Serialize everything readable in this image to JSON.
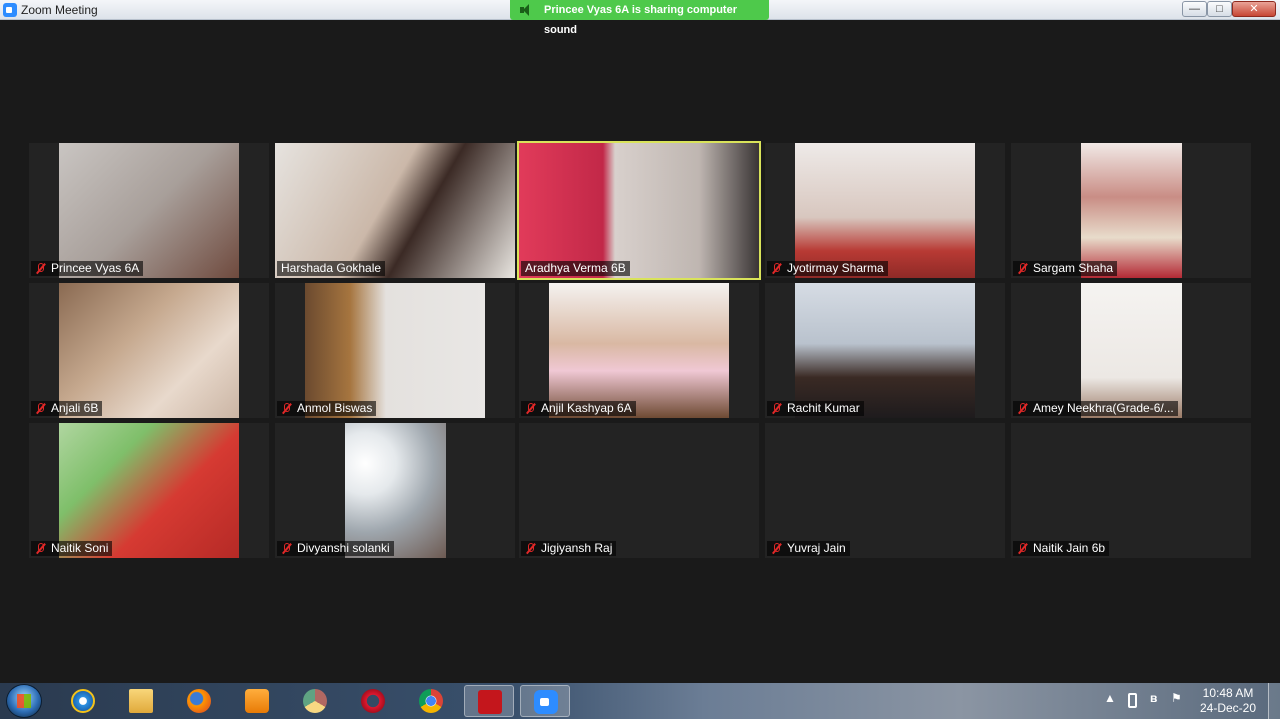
{
  "window": {
    "title": "Zoom Meeting",
    "share_banner": "Princee Vyas 6A is sharing computer sound",
    "controls": {
      "minimize": "—",
      "maximize": "□",
      "close": "✕"
    }
  },
  "participants": [
    {
      "name": "Princee Vyas 6A",
      "muted": true,
      "video": "mid",
      "bg": "linear-gradient(135deg,#c9c5c2 0%,#a89f9a 50%,#6f4a3e 100%)"
    },
    {
      "name": "Harshada Gokhale",
      "muted": false,
      "video": "full",
      "bg": "linear-gradient(120deg,#e6e3df 0%,#cbb8a9 45%,#3b2a25 60%,#e9e6e1 100%)"
    },
    {
      "name": "Aradhya Verma 6B",
      "muted": false,
      "active": true,
      "video": "full",
      "bg": "linear-gradient(90deg,#e13b5a 0%,#c22848 35%,#d8d0cc 40%,#bfb6b1 75%,#3a3535 100%)"
    },
    {
      "name": "Jyotirmay Sharma",
      "muted": true,
      "video": "mid",
      "bg": "linear-gradient(180deg,#eeeae8 0%,#d8c7bf 55%,#b83a34 80%,#8f2a27 100%)"
    },
    {
      "name": "Sargam Shaha",
      "muted": true,
      "video": "narrow",
      "bg": "linear-gradient(180deg,#f1e9e6 0%,#c98d85 40%,#e8dccb 70%,#b42a35 100%)"
    },
    {
      "name": "Anjali   6B",
      "muted": true,
      "video": "mid",
      "bg": "linear-gradient(135deg,#8a6a52 0%,#c6a98f 40%,#e8d9cc 70%,#cbb5a4 100%)"
    },
    {
      "name": "Anmol Biswas",
      "muted": true,
      "video": "mid",
      "bg": "linear-gradient(90deg,#6b4a2f 0%,#a6753f 25%,#e4e1de 45%,#e9e7e5 100%)"
    },
    {
      "name": "Anjil Kashyap 6A",
      "muted": true,
      "video": "mid",
      "bg": "linear-gradient(180deg,#f4f2f0 0%,#d9b8a3 45%,#f0c8d4 65%,#6e4a33 100%)"
    },
    {
      "name": "Rachit Kumar",
      "muted": true,
      "video": "mid",
      "bg": "linear-gradient(180deg,#d6dce4 0%,#b9c2cd 45%,#3a2a24 70%,#1e1b1d 100%)"
    },
    {
      "name": "Amey Neekhra(Grade-6/...",
      "muted": true,
      "video": "narrow",
      "bg": "linear-gradient(180deg,#f5f3f1 0%,#ece8e4 70%,#9a7a66 100%)"
    },
    {
      "name": "Naitik Soni",
      "muted": true,
      "video": "mid",
      "bg": "linear-gradient(135deg,#b0d6a0 0%,#7fbf6a 30%,#d63a32 60%,#b52a26 100%)"
    },
    {
      "name": "Divyanshi solanki",
      "muted": true,
      "video": "narrow",
      "bg": "radial-gradient(circle at 20% 30%,#ffffff 0%,#e5e9ec 25%,#9fa7ae 55%,#6d5a52 100%)"
    },
    {
      "name": "Jigiyansh Raj",
      "muted": true,
      "video": "none"
    },
    {
      "name": "Yuvraj Jain",
      "muted": true,
      "video": "none"
    },
    {
      "name": "Naitik Jain 6b",
      "muted": true,
      "video": "none"
    }
  ],
  "taskbar": {
    "apps": [
      {
        "name": "internet-explorer",
        "cls": "ie",
        "running": false
      },
      {
        "name": "file-explorer",
        "cls": "folder",
        "running": false
      },
      {
        "name": "firefox",
        "cls": "firefox",
        "running": false
      },
      {
        "name": "media-player",
        "cls": "media",
        "running": false
      },
      {
        "name": "chrome-canary",
        "cls": "chrome1",
        "running": false
      },
      {
        "name": "opera",
        "cls": "opera",
        "running": false
      },
      {
        "name": "chrome",
        "cls": "chrome2",
        "running": false
      },
      {
        "name": "adobe-reader",
        "cls": "pdf",
        "running": true
      },
      {
        "name": "zoom",
        "cls": "zoom",
        "running": true
      }
    ],
    "tray": {
      "arrow": "▲",
      "bluetooth": "ʙ",
      "flag": "⚑"
    },
    "clock": {
      "time": "10:48 AM",
      "date": "24-Dec-20"
    }
  }
}
